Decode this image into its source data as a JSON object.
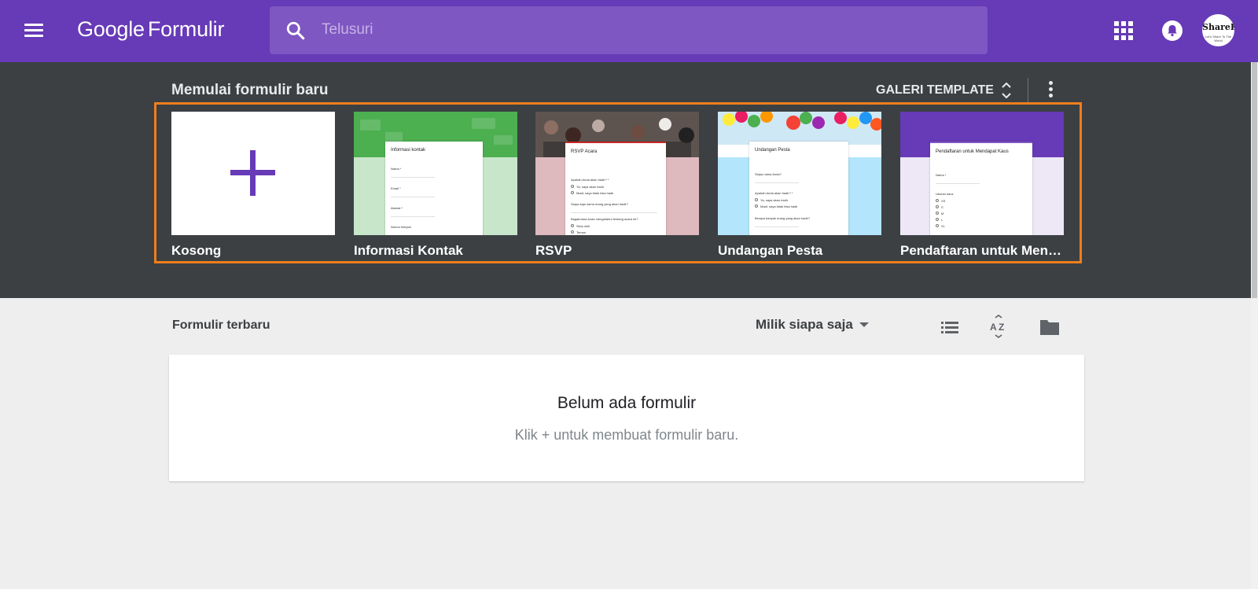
{
  "app": {
    "brand_google": "Google",
    "brand_product": "Formulir",
    "colors": {
      "primary": "#673ab7",
      "search_bg": "#7e57c2",
      "template_bg": "#3c4043",
      "highlight": "#f07e1c",
      "body_bg": "#eeeeee"
    }
  },
  "topbar": {
    "menu_icon": "hamburger-menu-icon",
    "search_icon": "search-icon",
    "search_placeholder": "Telusuri",
    "apps_icon": "apps-grid-icon",
    "notifications_icon": "bell-icon",
    "avatar_text": "ShareKu",
    "avatar_tagline": "Let's Share To The World"
  },
  "templates": {
    "section_title": "Memulai formulir baru",
    "gallery_label": "GALERI TEMPLATE",
    "gallery_icon": "expand-collapse-icon",
    "more_icon": "more-vert-icon",
    "items": [
      {
        "label": "Kosong",
        "icon": "plus-icon"
      },
      {
        "label": "Informasi Kontak",
        "preview_title": "Informasi kontak",
        "preview_questions": [
          "Nama *",
          "Email *",
          "Alamat *",
          "Nomor telepon"
        ]
      },
      {
        "label": "RSVP",
        "preview_title": "RSVP Acara",
        "preview_questions": [
          "Apakah Anda akan hadir? *",
          "Ya, saya akan hadir",
          "Maaf, saya tidak bisa hadir",
          "Siapa saja nama orang yang akan hadir?",
          "Bagaimana Anda mengetahui tentang acara ini?",
          "Situs web",
          "Teman"
        ]
      },
      {
        "label": "Undangan Pesta",
        "preview_title": "Undangan Pesta",
        "preview_questions": [
          "Siapa nama Anda?",
          "Apakah Anda akan hadir? *",
          "Ya, saya akan hadir",
          "Maaf, saya tidak bisa hadir",
          "Berapa banyak orang yang akan hadir?"
        ]
      },
      {
        "label": "Pendaftaran untuk Mendapat Kaus",
        "preview_title": "Pendaftaran untuk Mendapat Kaus",
        "preview_questions": [
          "Nama *",
          "Ukuran kaus",
          "XS",
          "S",
          "M",
          "L",
          "XL"
        ]
      }
    ]
  },
  "recent": {
    "title": "Formulir terbaru",
    "owner_filter": "Milik siapa saja",
    "list_view_icon": "list-view-icon",
    "sort_icon": "sort-az-icon",
    "folder_icon": "folder-icon",
    "empty_title": "Belum ada formulir",
    "empty_subtitle": "Klik + untuk membuat formulir baru."
  }
}
